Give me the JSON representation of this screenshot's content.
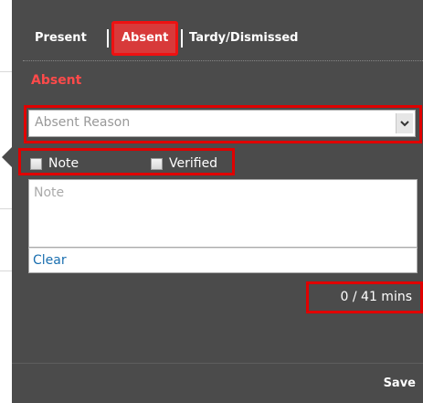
{
  "tabs": [
    {
      "label": "Present"
    },
    {
      "label": "Absent"
    },
    {
      "label": "Tardy/Dismissed"
    }
  ],
  "section_title": "Absent",
  "reason_select": {
    "placeholder": "Absent Reason"
  },
  "checkboxes": [
    {
      "label": "Note",
      "checked": false
    },
    {
      "label": "Verified",
      "checked": false
    }
  ],
  "note": {
    "placeholder": "Note",
    "clear_label": "Clear"
  },
  "minutes": "0 / 41 mins",
  "save_label": "Save",
  "colors": {
    "panel": "#4b4b4b",
    "accent": "#d83a3a",
    "highlight": "#e00000",
    "title": "#ff4a4a",
    "link": "#1a6fb0"
  }
}
